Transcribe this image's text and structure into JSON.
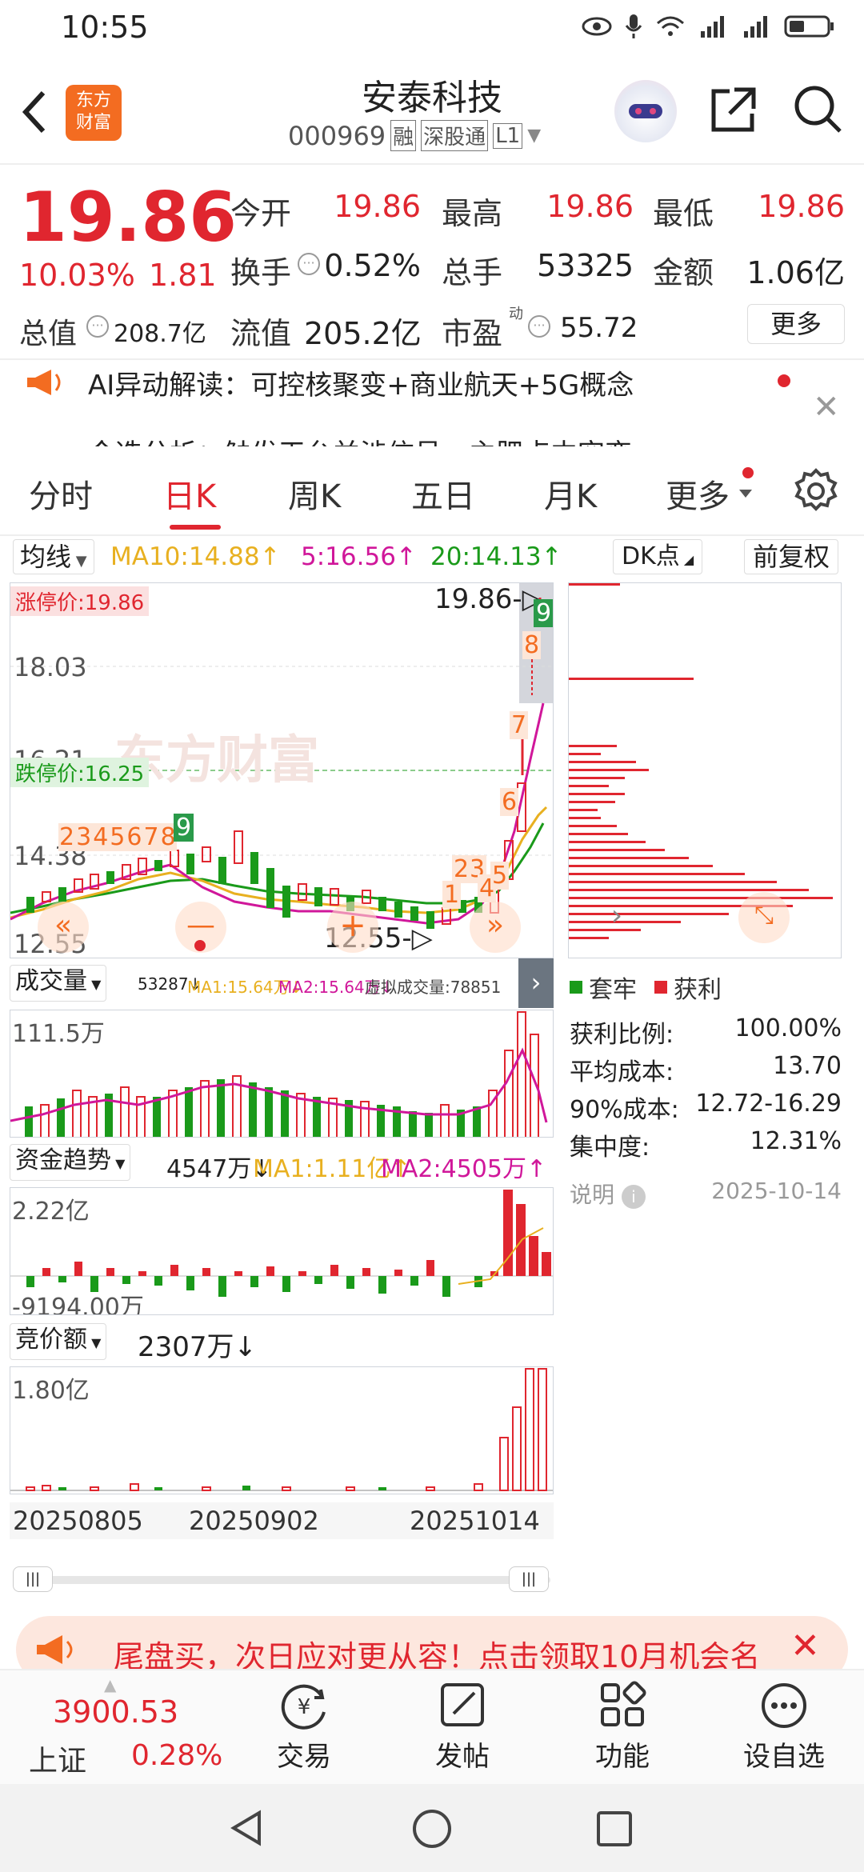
{
  "status": {
    "time": "10:55"
  },
  "header": {
    "logo_line1": "东方",
    "logo_line2": "财富",
    "title": "安泰科技",
    "code": "000969",
    "tag1": "融",
    "tag2": "深股通",
    "tag3": "L1"
  },
  "quote": {
    "price": "19.86",
    "change_pct": "10.03%",
    "change": "1.81",
    "open_label": "今开",
    "open": "19.86",
    "high_label": "最高",
    "high": "19.86",
    "low_label": "最低",
    "low": "19.86",
    "turnover_label": "换手",
    "turnover": "0.52%",
    "volume_label": "总手",
    "volume": "53325",
    "amount_label": "金额",
    "amount": "1.06亿",
    "mktcap_label": "总值",
    "mktcap": "208.7亿",
    "float_label": "流值",
    "float": "205.2亿",
    "pe_label": "市盈",
    "pe_sup": "动",
    "pe": "55.72",
    "more": "更多"
  },
  "news": {
    "line1": "AI异动解读：可控核聚变+商业航天+5G概念",
    "line2": "今选分析：触发天台并涉信号，主肥点中突变"
  },
  "tabs": [
    "分时",
    "日K",
    "周K",
    "五日",
    "月K",
    "更多"
  ],
  "active_tab": "日K",
  "ma_bar": {
    "label": "均线",
    "ma10": "MA10:14.88↑",
    "ma5": "5:16.56↑",
    "ma20": "20:14.13↑",
    "dk": "DK点",
    "fq": "前复权"
  },
  "kline": {
    "limit_up": "涨停价:19.86",
    "limit_down": "跌停价:16.25",
    "y_labels": [
      "18.03",
      "14.38",
      "12.55"
    ],
    "y_top": "16.21",
    "max_label": "19.86",
    "min_label": "12.55",
    "watermark": "东方财富",
    "nine_left": [
      "2",
      "3",
      "4",
      "5",
      "6",
      "7",
      "8",
      "9"
    ],
    "nine_right": [
      "1",
      "2",
      "3",
      "4",
      "5",
      "6",
      "7",
      "8",
      "9"
    ]
  },
  "volume": {
    "label": "成交量",
    "info": "53287↓",
    "ma1": "MA1:15.64万↓",
    "ma2": "MA2:15.64万↓",
    "virtual": "虚拟成交量:78851",
    "y_top": "111.5万"
  },
  "fund": {
    "label": "资金趋势",
    "value": "4547万↓",
    "ma1": "MA1:1.11亿↑",
    "ma2": "MA2:4505万↑",
    "y_top": "2.22亿",
    "y_bottom": "-9194.00万"
  },
  "auction": {
    "label": "竞价额",
    "value": "2307万↓",
    "y_top": "1.80亿"
  },
  "dates": [
    "20250805",
    "20250902",
    "20251014"
  ],
  "chips": {
    "legend_trap": "套牢",
    "legend_profit": "获利",
    "rows": [
      {
        "label": "获利比例:",
        "value": "100.00%"
      },
      {
        "label": "平均成本:",
        "value": "13.70"
      },
      {
        "label": "90%成本:",
        "value": "12.72-16.29"
      },
      {
        "label": "集中度:",
        "value": "12.31%"
      }
    ],
    "note": "说明",
    "date": "2025-10-14"
  },
  "banner": {
    "text": "尾盘买，次日应对更从容！点击领取10月机会名"
  },
  "bottom": {
    "index_value": "3900.53",
    "index_name": "上证",
    "index_pct": "0.28%",
    "trade": "交易",
    "post": "发帖",
    "func": "功能",
    "watch": "设自选"
  },
  "colors": {
    "up": "#e0262f",
    "down": "#1a9a1a",
    "ma5": "#d0179a",
    "ma10": "#e8b020",
    "ma20": "#1a9a1a",
    "accent": "#f36c21"
  }
}
